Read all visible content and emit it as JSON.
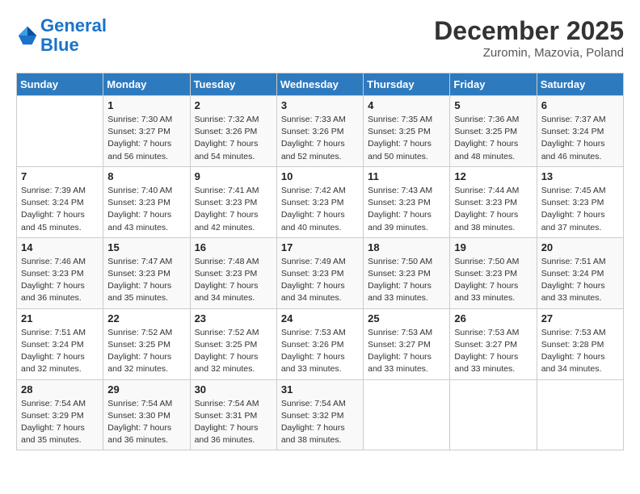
{
  "header": {
    "logo_line1": "General",
    "logo_line2": "Blue",
    "month_title": "December 2025",
    "subtitle": "Zuromin, Mazovia, Poland"
  },
  "days_of_week": [
    "Sunday",
    "Monday",
    "Tuesday",
    "Wednesday",
    "Thursday",
    "Friday",
    "Saturday"
  ],
  "weeks": [
    [
      {
        "day": "",
        "sunrise": "",
        "sunset": "",
        "daylight": ""
      },
      {
        "day": "1",
        "sunrise": "7:30 AM",
        "sunset": "3:27 PM",
        "daylight": "7 hours and 56 minutes."
      },
      {
        "day": "2",
        "sunrise": "7:32 AM",
        "sunset": "3:26 PM",
        "daylight": "7 hours and 54 minutes."
      },
      {
        "day": "3",
        "sunrise": "7:33 AM",
        "sunset": "3:26 PM",
        "daylight": "7 hours and 52 minutes."
      },
      {
        "day": "4",
        "sunrise": "7:35 AM",
        "sunset": "3:25 PM",
        "daylight": "7 hours and 50 minutes."
      },
      {
        "day": "5",
        "sunrise": "7:36 AM",
        "sunset": "3:25 PM",
        "daylight": "7 hours and 48 minutes."
      },
      {
        "day": "6",
        "sunrise": "7:37 AM",
        "sunset": "3:24 PM",
        "daylight": "7 hours and 46 minutes."
      }
    ],
    [
      {
        "day": "7",
        "sunrise": "7:39 AM",
        "sunset": "3:24 PM",
        "daylight": "7 hours and 45 minutes."
      },
      {
        "day": "8",
        "sunrise": "7:40 AM",
        "sunset": "3:23 PM",
        "daylight": "7 hours and 43 minutes."
      },
      {
        "day": "9",
        "sunrise": "7:41 AM",
        "sunset": "3:23 PM",
        "daylight": "7 hours and 42 minutes."
      },
      {
        "day": "10",
        "sunrise": "7:42 AM",
        "sunset": "3:23 PM",
        "daylight": "7 hours and 40 minutes."
      },
      {
        "day": "11",
        "sunrise": "7:43 AM",
        "sunset": "3:23 PM",
        "daylight": "7 hours and 39 minutes."
      },
      {
        "day": "12",
        "sunrise": "7:44 AM",
        "sunset": "3:23 PM",
        "daylight": "7 hours and 38 minutes."
      },
      {
        "day": "13",
        "sunrise": "7:45 AM",
        "sunset": "3:23 PM",
        "daylight": "7 hours and 37 minutes."
      }
    ],
    [
      {
        "day": "14",
        "sunrise": "7:46 AM",
        "sunset": "3:23 PM",
        "daylight": "7 hours and 36 minutes."
      },
      {
        "day": "15",
        "sunrise": "7:47 AM",
        "sunset": "3:23 PM",
        "daylight": "7 hours and 35 minutes."
      },
      {
        "day": "16",
        "sunrise": "7:48 AM",
        "sunset": "3:23 PM",
        "daylight": "7 hours and 34 minutes."
      },
      {
        "day": "17",
        "sunrise": "7:49 AM",
        "sunset": "3:23 PM",
        "daylight": "7 hours and 34 minutes."
      },
      {
        "day": "18",
        "sunrise": "7:50 AM",
        "sunset": "3:23 PM",
        "daylight": "7 hours and 33 minutes."
      },
      {
        "day": "19",
        "sunrise": "7:50 AM",
        "sunset": "3:23 PM",
        "daylight": "7 hours and 33 minutes."
      },
      {
        "day": "20",
        "sunrise": "7:51 AM",
        "sunset": "3:24 PM",
        "daylight": "7 hours and 33 minutes."
      }
    ],
    [
      {
        "day": "21",
        "sunrise": "7:51 AM",
        "sunset": "3:24 PM",
        "daylight": "7 hours and 32 minutes."
      },
      {
        "day": "22",
        "sunrise": "7:52 AM",
        "sunset": "3:25 PM",
        "daylight": "7 hours and 32 minutes."
      },
      {
        "day": "23",
        "sunrise": "7:52 AM",
        "sunset": "3:25 PM",
        "daylight": "7 hours and 32 minutes."
      },
      {
        "day": "24",
        "sunrise": "7:53 AM",
        "sunset": "3:26 PM",
        "daylight": "7 hours and 33 minutes."
      },
      {
        "day": "25",
        "sunrise": "7:53 AM",
        "sunset": "3:27 PM",
        "daylight": "7 hours and 33 minutes."
      },
      {
        "day": "26",
        "sunrise": "7:53 AM",
        "sunset": "3:27 PM",
        "daylight": "7 hours and 33 minutes."
      },
      {
        "day": "27",
        "sunrise": "7:53 AM",
        "sunset": "3:28 PM",
        "daylight": "7 hours and 34 minutes."
      }
    ],
    [
      {
        "day": "28",
        "sunrise": "7:54 AM",
        "sunset": "3:29 PM",
        "daylight": "7 hours and 35 minutes."
      },
      {
        "day": "29",
        "sunrise": "7:54 AM",
        "sunset": "3:30 PM",
        "daylight": "7 hours and 36 minutes."
      },
      {
        "day": "30",
        "sunrise": "7:54 AM",
        "sunset": "3:31 PM",
        "daylight": "7 hours and 36 minutes."
      },
      {
        "day": "31",
        "sunrise": "7:54 AM",
        "sunset": "3:32 PM",
        "daylight": "7 hours and 38 minutes."
      },
      {
        "day": "",
        "sunrise": "",
        "sunset": "",
        "daylight": ""
      },
      {
        "day": "",
        "sunrise": "",
        "sunset": "",
        "daylight": ""
      },
      {
        "day": "",
        "sunrise": "",
        "sunset": "",
        "daylight": ""
      }
    ]
  ],
  "labels": {
    "sunrise_prefix": "Sunrise: ",
    "sunset_prefix": "Sunset: ",
    "daylight_prefix": "Daylight: "
  }
}
